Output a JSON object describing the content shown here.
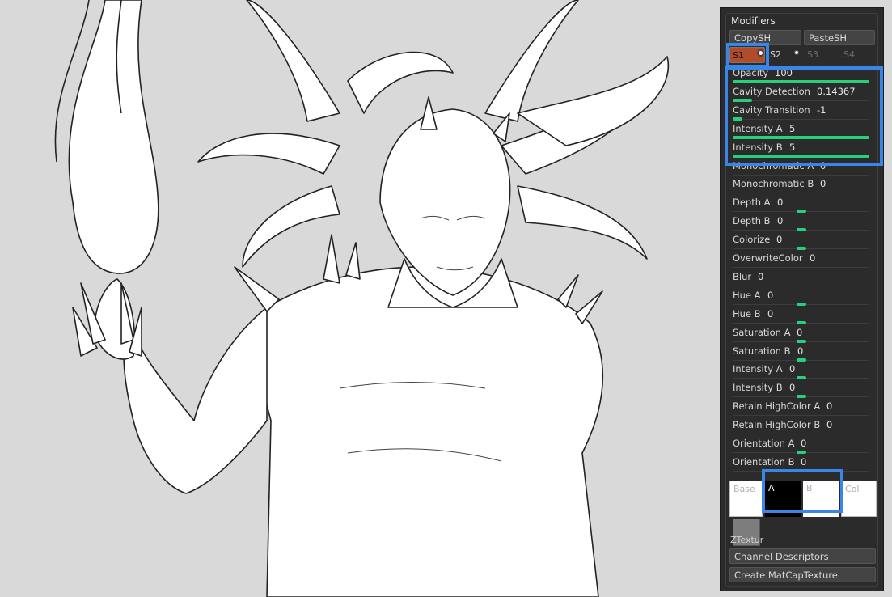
{
  "panel": {
    "title": "Modifiers",
    "copy_label": "CopySH",
    "paste_label": "PasteSH",
    "slots": [
      "S1",
      "S2",
      "S3",
      "S4"
    ],
    "sliders": [
      {
        "label": "Opacity",
        "value": "100",
        "fill": 1.0,
        "style": "fill"
      },
      {
        "label": "Cavity Detection",
        "value": "0.14367",
        "fill": 0.14,
        "style": "fill"
      },
      {
        "label": "Cavity Transition",
        "value": "-1",
        "fill": 0.07,
        "style": "fill"
      },
      {
        "label": "Intensity A",
        "value": "5",
        "fill": 1.0,
        "style": "fill"
      },
      {
        "label": "Intensity B",
        "value": "5",
        "fill": 1.0,
        "style": "fill"
      },
      {
        "label": "Monochromatic A",
        "value": "0",
        "fill": 0,
        "style": "none"
      },
      {
        "label": "Monochromatic B",
        "value": "0",
        "fill": 0,
        "style": "none"
      },
      {
        "label": "Depth A",
        "value": "0",
        "fill": 0.5,
        "style": "knob"
      },
      {
        "label": "Depth B",
        "value": "0",
        "fill": 0.5,
        "style": "knob"
      },
      {
        "label": "Colorize",
        "value": "0",
        "fill": 0.5,
        "style": "knob"
      },
      {
        "label": "OverwriteColor",
        "value": "0",
        "fill": 0,
        "style": "none"
      },
      {
        "label": "Blur",
        "value": "0",
        "fill": 0,
        "style": "none"
      },
      {
        "label": "Hue A",
        "value": "0",
        "fill": 0.5,
        "style": "knob"
      },
      {
        "label": "Hue B",
        "value": "0",
        "fill": 0.5,
        "style": "knob"
      },
      {
        "label": "Saturation A",
        "value": "0",
        "fill": 0.5,
        "style": "knob"
      },
      {
        "label": "Saturation B",
        "value": "0",
        "fill": 0.5,
        "style": "knob"
      },
      {
        "label": "Intensity A",
        "value": "0",
        "fill": 0.5,
        "style": "knob"
      },
      {
        "label": "Intensity B",
        "value": "0",
        "fill": 0.5,
        "style": "knob"
      },
      {
        "label": "Retain HighColor A",
        "value": "0",
        "fill": 0,
        "style": "none"
      },
      {
        "label": "Retain HighColor B",
        "value": "0",
        "fill": 0,
        "style": "none"
      },
      {
        "label": "Orientation A",
        "value": "0",
        "fill": 0.5,
        "style": "knob"
      },
      {
        "label": "Orientation B",
        "value": "0",
        "fill": 0.5,
        "style": "knob"
      }
    ],
    "swatches": [
      {
        "label": "Base",
        "color": "#ffffff",
        "text_color": "#b0b0b0"
      },
      {
        "label": "A",
        "color": "#000000",
        "text_color": "#ffffff"
      },
      {
        "label": "B",
        "color": "#ffffff",
        "text_color": "#b0b0b0"
      },
      {
        "label": "Col",
        "color": "#ffffff",
        "text_color": "#b0b0b0"
      }
    ],
    "ztexture_label": "ZTextur",
    "channel_descriptors_label": "Channel Descriptors",
    "create_matcap_label": "Create MatCapTexture"
  },
  "colors": {
    "slider_green": "#26d07c",
    "active_slot": "#b14b2a",
    "highlight": "#3a86e8",
    "panel_bg": "#2b2b2b",
    "canvas_bg": "#d9d9d9"
  }
}
